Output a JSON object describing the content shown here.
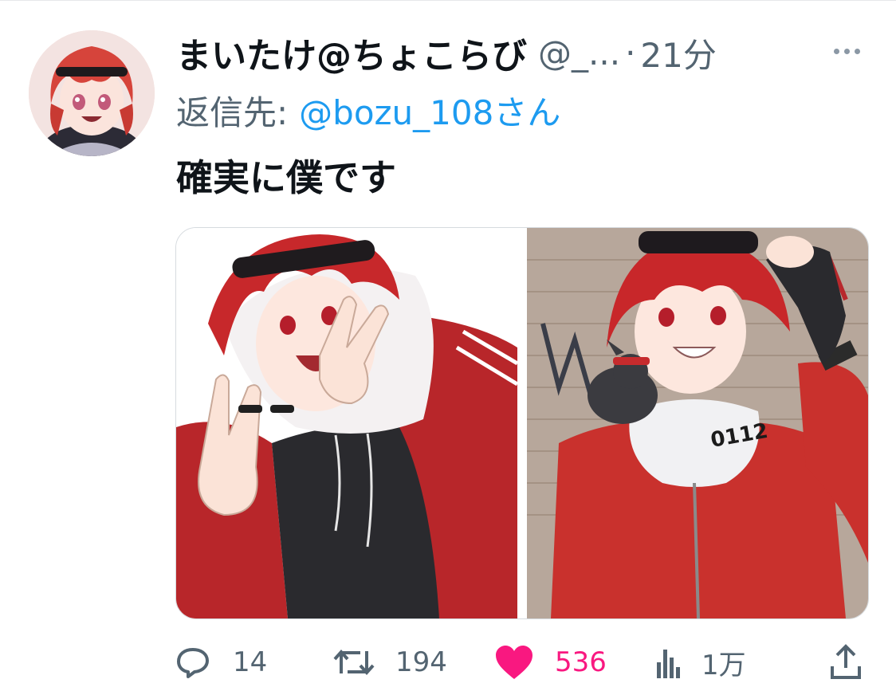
{
  "tweet": {
    "author": {
      "display_name": "まいたけ@ちょこらび",
      "handle": "@_...",
      "separator": "·",
      "time": "21分"
    },
    "reply": {
      "prefix": "返信先:",
      "target": "@bozu_108さん"
    },
    "text": "確実に僕です",
    "media_count": 2
  },
  "actions": {
    "replies": "14",
    "retweets": "194",
    "likes": "536",
    "views": "1万"
  },
  "icons": {
    "reply": "speech-bubble-icon",
    "retweet": "retweet-arrows-icon",
    "like": "heart-icon",
    "views": "bar-chart-icon",
    "share": "share-upload-icon",
    "more": "more-dots-icon"
  },
  "colors": {
    "text_primary": "#0f1419",
    "text_secondary": "#536471",
    "link": "#1d9bf0",
    "like": "#f91880"
  }
}
